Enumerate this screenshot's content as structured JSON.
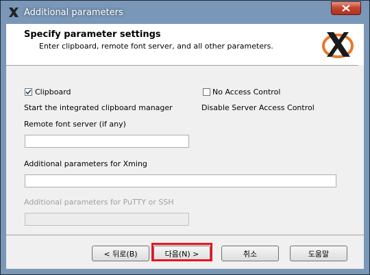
{
  "window": {
    "title": "Additional parameters"
  },
  "header": {
    "title": "Specify parameter settings",
    "subtitle": "Enter clipboard, remote font server, and all other parameters."
  },
  "options": {
    "clipboard": {
      "label": "Clipboard",
      "checked": true,
      "description": "Start the integrated clipboard manager"
    },
    "no_access_control": {
      "label": "No Access Control",
      "checked": false,
      "description": "Disable Server Access Control"
    }
  },
  "fields": {
    "remote_font_server": {
      "label": "Remote font server (if any)",
      "value": ""
    },
    "xming_params": {
      "label": "Additional parameters for Xming",
      "value": ""
    },
    "putty_params": {
      "label": "Additional parameters for PuTTY or SSH",
      "value": "",
      "disabled": true
    }
  },
  "buttons": {
    "back": "< 뒤로(B)",
    "next": "다음(N) >",
    "cancel": "취소",
    "help": "도움말"
  },
  "colors": {
    "highlight": "#e8141e",
    "logo_orange": "#e8782a"
  },
  "icons": {
    "title": "xming-logo-icon",
    "close": "close-icon",
    "header": "xming-logo-icon"
  }
}
